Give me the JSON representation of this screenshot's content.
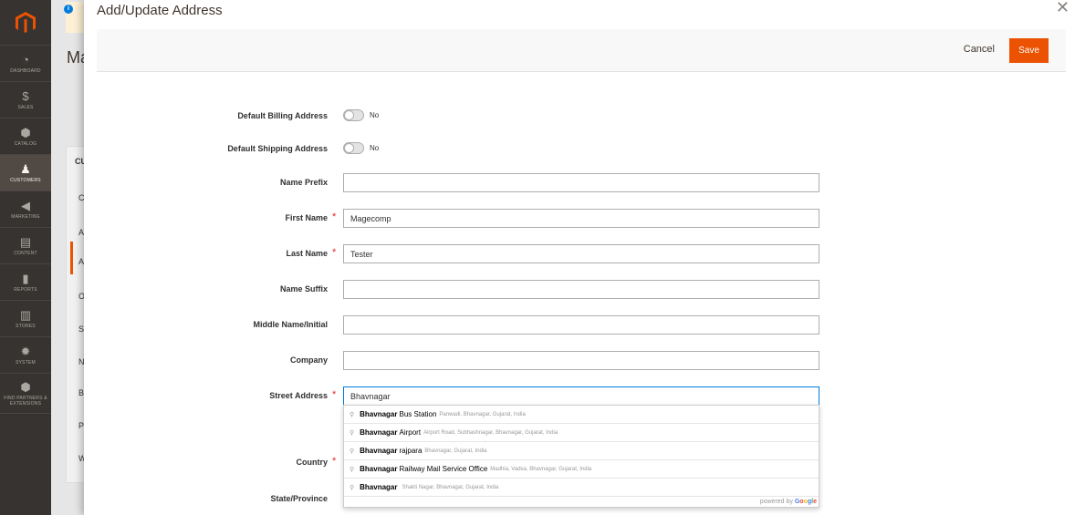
{
  "sidebar": {
    "items": [
      {
        "label": "DASHBOARD",
        "icon": "dashboard-icon",
        "glyph": "◔",
        "active": false
      },
      {
        "label": "SALES",
        "icon": "dollar-icon",
        "glyph": "$",
        "active": false
      },
      {
        "label": "CATALOG",
        "icon": "cube-icon",
        "glyph": "⬢",
        "active": false
      },
      {
        "label": "CUSTOMERS",
        "icon": "person-icon",
        "glyph": "♟",
        "active": true
      },
      {
        "label": "MARKETING",
        "icon": "megaphone-icon",
        "glyph": "◀",
        "active": false
      },
      {
        "label": "CONTENT",
        "icon": "content-icon",
        "glyph": "▤",
        "active": false
      },
      {
        "label": "REPORTS",
        "icon": "bar-chart-icon",
        "glyph": "▮",
        "active": false
      },
      {
        "label": "STORES",
        "icon": "store-icon",
        "glyph": "▥",
        "active": false
      },
      {
        "label": "SYSTEM",
        "icon": "gear-icon",
        "glyph": "✹",
        "active": false
      },
      {
        "label": "FIND PARTNERS & EXTENSIONS",
        "icon": "partners-icon",
        "glyph": "⬢",
        "active": false
      }
    ]
  },
  "background": {
    "page_title": "Ma",
    "tab_letters": [
      "CU",
      "C",
      "A",
      "A",
      "O",
      "S",
      "N",
      "B",
      "P",
      "W"
    ]
  },
  "modal": {
    "title": "Add/Update Address",
    "close_glyph": "✕",
    "cancel_label": "Cancel",
    "save_label": "Save"
  },
  "form": {
    "default_billing": {
      "label": "Default Billing Address",
      "state": "No"
    },
    "default_shipping": {
      "label": "Default Shipping Address",
      "state": "No"
    },
    "name_prefix": {
      "label": "Name Prefix",
      "value": ""
    },
    "first_name": {
      "label": "First Name",
      "value": "Magecomp",
      "required_mark": "*"
    },
    "last_name": {
      "label": "Last Name",
      "value": "Tester",
      "required_mark": "*"
    },
    "name_suffix": {
      "label": "Name Suffix",
      "value": ""
    },
    "middle_name": {
      "label": "Middle Name/Initial",
      "value": ""
    },
    "company": {
      "label": "Company",
      "value": ""
    },
    "street": {
      "label": "Street Address",
      "value": "Bhavnagar",
      "required_mark": "*"
    },
    "country": {
      "label": "Country",
      "required_mark": "*"
    },
    "state": {
      "label": "State/Province"
    }
  },
  "autocomplete": {
    "pin_glyph": "⚲",
    "items": [
      {
        "match": "Bhavnagar",
        "main": "Bus Station",
        "secondary": "Panwadi, Bhavnagar, Gujarat, India"
      },
      {
        "match": "Bhavnagar",
        "main": "Airport",
        "secondary": "Airport Road, Subhashnagar, Bhavnagar, Gujarat, India"
      },
      {
        "match": "Bhavnagar",
        "main": "rajpara",
        "secondary": "Bhavnagar, Gujarat, India"
      },
      {
        "match": "Bhavnagar",
        "main": "Railway Mail Service Office",
        "secondary": "Madhia, Vadva, Bhavnagar, Gujarat, India"
      },
      {
        "match": "Bhavnagar",
        "main": "",
        "secondary": "Shakti Nagar, Bhavnagar, Gujarat, India"
      }
    ],
    "footer_prefix": "powered by",
    "footer_brand": [
      "G",
      "o",
      "o",
      "g",
      "l",
      "e"
    ]
  }
}
